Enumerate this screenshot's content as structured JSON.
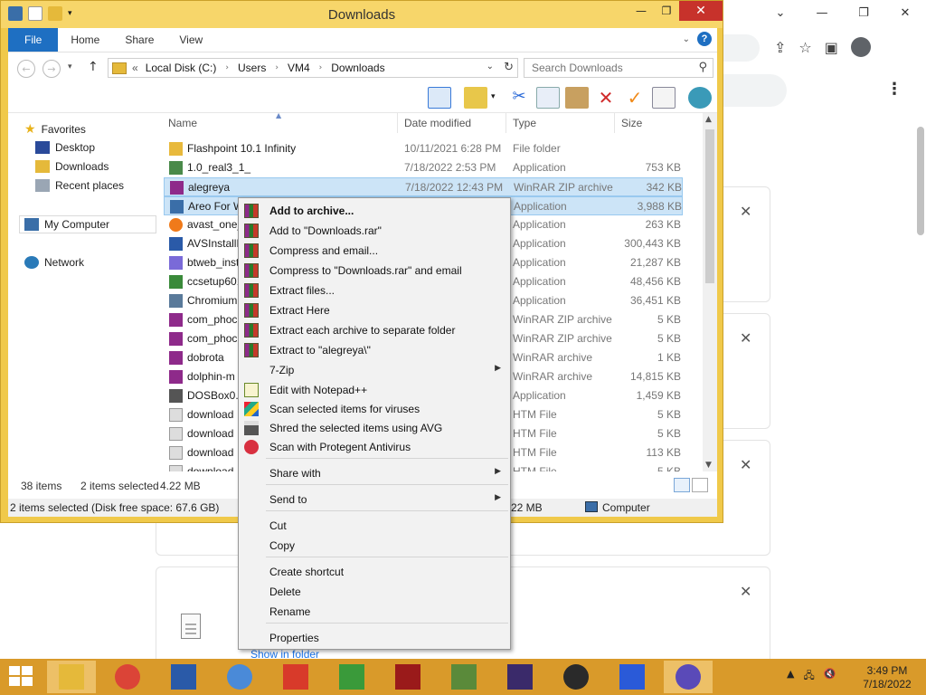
{
  "explorer": {
    "title": "Downloads",
    "ribbon_tabs": [
      "File",
      "Home",
      "Share",
      "View"
    ],
    "address": {
      "root_marker": "«",
      "segments": [
        "Local Disk (C:)",
        "Users",
        "VM4",
        "Downloads"
      ]
    },
    "search_placeholder": "Search Downloads",
    "nav_pane": {
      "favorites": "Favorites",
      "desktop": "Desktop",
      "downloads": "Downloads",
      "recent": "Recent places",
      "computer": "My Computer",
      "network": "Network"
    },
    "columns": {
      "name": "Name",
      "date": "Date modified",
      "type": "Type",
      "size": "Size"
    },
    "files": [
      {
        "name": "Flashpoint 10.1 Infinity",
        "date": "10/11/2021 6:28 PM",
        "type": "File folder",
        "size": "",
        "icon": "folder-icon",
        "color": "#e8b93c",
        "selected": false
      },
      {
        "name": "1.0_real3_1_",
        "date": "7/18/2022 2:53 PM",
        "type": "Application",
        "size": "753 KB",
        "icon": "app-icon",
        "color": "#4a8a4a",
        "selected": false
      },
      {
        "name": "alegreya",
        "date": "7/18/2022 12:43 PM",
        "type": "WinRAR ZIP archive",
        "size": "342 KB",
        "icon": "winrar-icon",
        "color": "#8e2a8a",
        "selected": true
      },
      {
        "name": "Areo For W",
        "date": "",
        "type": "Application",
        "size": "3,988 KB",
        "icon": "app-icon",
        "color": "#3a6ea8",
        "selected": true
      },
      {
        "name": "avast_one_",
        "date": "",
        "type": "Application",
        "size": "263 KB",
        "icon": "avast-icon",
        "color": "#f07a1a",
        "selected": false
      },
      {
        "name": "AVSInstallP",
        "date": "",
        "type": "Application",
        "size": "300,443 KB",
        "icon": "app-icon",
        "color": "#2a5aa8",
        "selected": false
      },
      {
        "name": "btweb_inst",
        "date": "",
        "type": "Application",
        "size": "21,287 KB",
        "icon": "app-icon",
        "color": "#7a6ad8",
        "selected": false
      },
      {
        "name": "ccsetup601",
        "date": "",
        "type": "Application",
        "size": "48,456 KB",
        "icon": "app-icon",
        "color": "#3a8a3a",
        "selected": false
      },
      {
        "name": "Chromium",
        "date": "",
        "type": "Application",
        "size": "36,451 KB",
        "icon": "app-icon",
        "color": "#5a7a9a",
        "selected": false
      },
      {
        "name": "com_phoc",
        "date": "",
        "type": "WinRAR ZIP archive",
        "size": "5 KB",
        "icon": "winrar-icon",
        "color": "#8e2a8a",
        "selected": false
      },
      {
        "name": "com_phoc",
        "date": "",
        "type": "WinRAR ZIP archive",
        "size": "5 KB",
        "icon": "winrar-icon",
        "color": "#8e2a8a",
        "selected": false
      },
      {
        "name": "dobrota",
        "date": "",
        "type": "WinRAR archive",
        "size": "1 KB",
        "icon": "winrar-icon",
        "color": "#8e2a8a",
        "selected": false
      },
      {
        "name": "dolphin-m",
        "date": "",
        "type": "WinRAR archive",
        "size": "14,815 KB",
        "icon": "winrar-icon",
        "color": "#8e2a8a",
        "selected": false
      },
      {
        "name": "DOSBox0.7",
        "date": "",
        "type": "Application",
        "size": "1,459 KB",
        "icon": "app-icon",
        "color": "#555555",
        "selected": false
      },
      {
        "name": "download",
        "date": "",
        "type": "HTM File",
        "size": "5 KB",
        "icon": "document-icon",
        "color": "#dddddd",
        "selected": false
      },
      {
        "name": "download",
        "date": "",
        "type": "HTM File",
        "size": "5 KB",
        "icon": "document-icon",
        "color": "#dddddd",
        "selected": false
      },
      {
        "name": "download",
        "date": "",
        "type": "HTM File",
        "size": "113 KB",
        "icon": "document-icon",
        "color": "#dddddd",
        "selected": false
      },
      {
        "name": "download",
        "date": "",
        "type": "HTM File",
        "size": "5 KB",
        "icon": "document-icon",
        "color": "#dddddd",
        "selected": false
      }
    ],
    "pane_status": {
      "count": "38 items",
      "selected": "2 items selected",
      "size": "4.22 MB"
    },
    "status_bar": {
      "left": "2 items selected (Disk free space: 67.6 GB)",
      "mid": "22 MB",
      "right": "Computer"
    }
  },
  "context_menu": {
    "items": [
      {
        "label": "Add to archive...",
        "icon": "winrar-icon",
        "bold": true,
        "submenu": false
      },
      {
        "label": "Add to \"Downloads.rar\"",
        "icon": "winrar-icon",
        "bold": false,
        "submenu": false
      },
      {
        "label": "Compress and email...",
        "icon": "winrar-icon",
        "bold": false,
        "submenu": false
      },
      {
        "label": "Compress to \"Downloads.rar\" and email",
        "icon": "winrar-icon",
        "bold": false,
        "submenu": false
      },
      {
        "label": "Extract files...",
        "icon": "winrar-icon",
        "bold": false,
        "submenu": false
      },
      {
        "label": "Extract Here",
        "icon": "winrar-icon",
        "bold": false,
        "submenu": false
      },
      {
        "label": "Extract each archive to separate folder",
        "icon": "winrar-icon",
        "bold": false,
        "submenu": false
      },
      {
        "label": "Extract to \"alegreya\\\"",
        "icon": "winrar-icon",
        "bold": false,
        "submenu": false
      },
      {
        "label": "7-Zip",
        "icon": "",
        "bold": false,
        "submenu": true
      },
      {
        "label": "Edit with Notepad++",
        "icon": "notepad-icon",
        "bold": false,
        "submenu": false
      },
      {
        "label": "Scan selected items for viruses",
        "icon": "avg-icon",
        "bold": false,
        "submenu": false
      },
      {
        "label": "Shred the selected items using AVG",
        "icon": "shredder-icon",
        "bold": false,
        "submenu": false
      },
      {
        "label": "Scan with Protegent Antivirus",
        "icon": "protegent-icon",
        "bold": false,
        "submenu": false
      },
      {
        "label": "Share with",
        "icon": "",
        "bold": false,
        "submenu": true
      },
      {
        "label": "Send to",
        "icon": "",
        "bold": false,
        "submenu": true
      },
      {
        "label": "Cut",
        "icon": "",
        "bold": false,
        "submenu": false
      },
      {
        "label": "Copy",
        "icon": "",
        "bold": false,
        "submenu": false
      },
      {
        "label": "Create shortcut",
        "icon": "",
        "bold": false,
        "submenu": false
      },
      {
        "label": "Delete",
        "icon": "",
        "bold": false,
        "submenu": false
      },
      {
        "label": "Rename",
        "icon": "",
        "bold": false,
        "submenu": false
      },
      {
        "label": "Properties",
        "icon": "",
        "bold": false,
        "submenu": false
      }
    ]
  },
  "browser": {
    "show_in_folder": "Show in folder"
  },
  "taskbar": {
    "apps": [
      {
        "name": "file-explorer",
        "color": "#e5b93a",
        "active": true
      },
      {
        "name": "chrome",
        "color": "#db4437",
        "active": false
      },
      {
        "name": "remote-desktop",
        "color": "#2a5aa8",
        "active": false
      },
      {
        "name": "chromium",
        "color": "#4a8ad8",
        "active": false
      },
      {
        "name": "arrow-app",
        "color": "#d83a2a",
        "active": false
      },
      {
        "name": "avg",
        "color": "#3a9a3a",
        "active": false
      },
      {
        "name": "flash",
        "color": "#9a1a1a",
        "active": false
      },
      {
        "name": "minecraft",
        "color": "#5a8a3a",
        "active": false
      },
      {
        "name": "video-editor",
        "color": "#3a2a6a",
        "active": false
      },
      {
        "name": "obs",
        "color": "#2a2a2a",
        "active": false
      },
      {
        "name": "audacity",
        "color": "#2a5ad8",
        "active": false
      },
      {
        "name": "settings",
        "color": "#5a4ab8",
        "active": true
      }
    ],
    "time": "3:49 PM",
    "date": "7/18/2022"
  }
}
